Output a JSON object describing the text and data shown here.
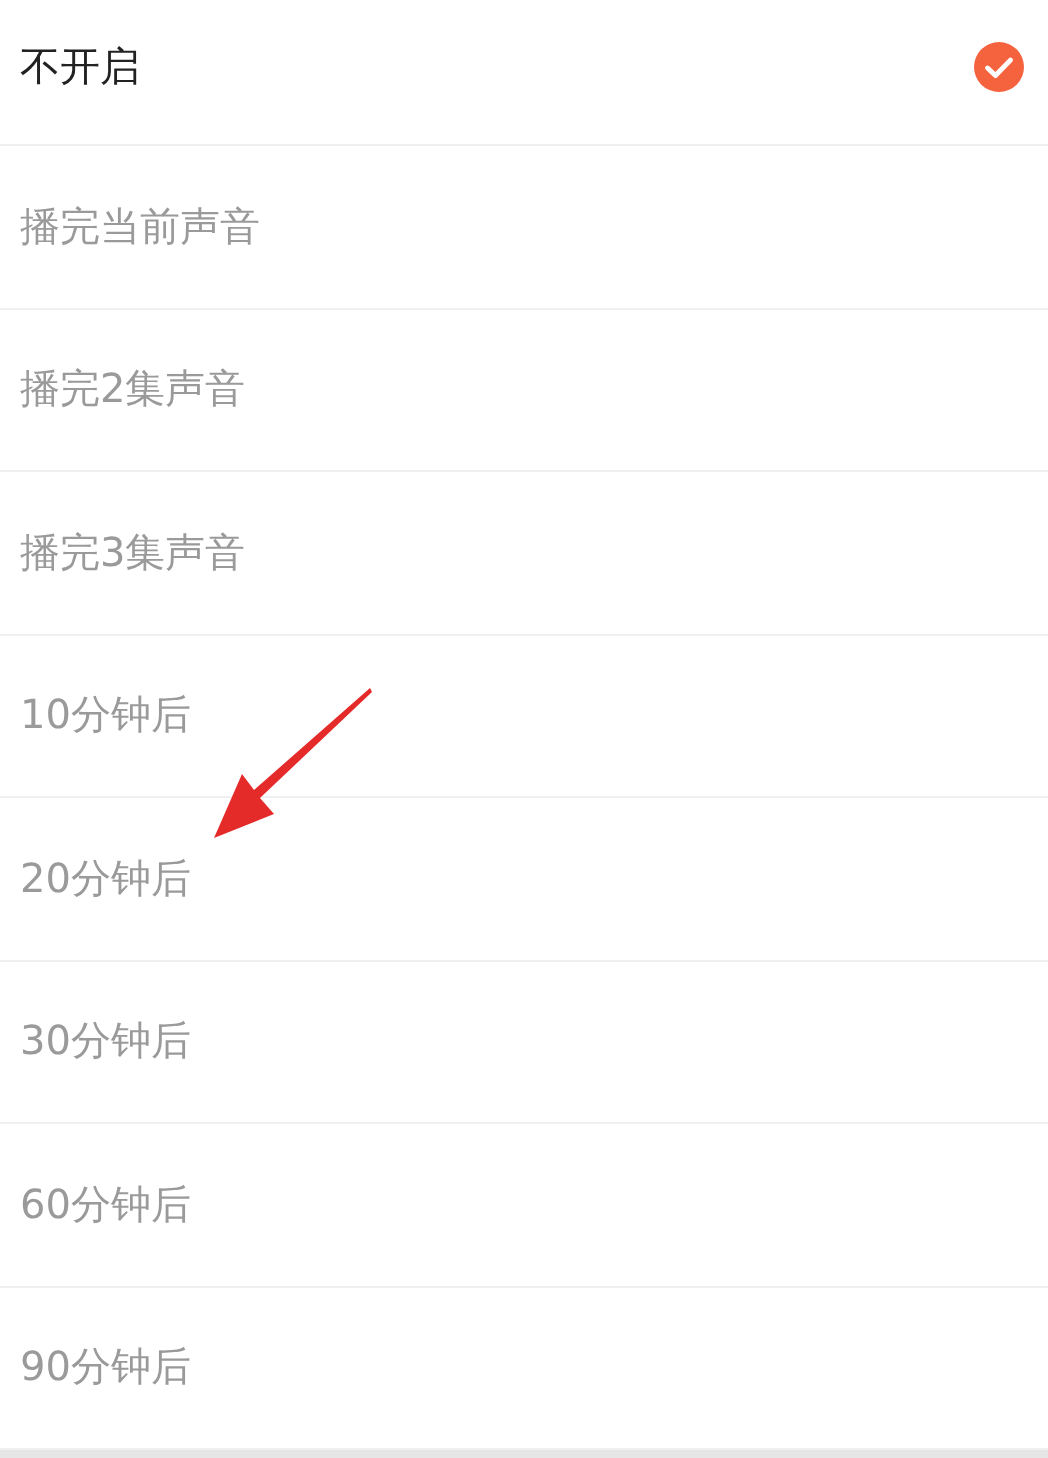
{
  "options": [
    {
      "label": "不开启",
      "selected": true
    },
    {
      "label": "播完当前声音",
      "selected": false
    },
    {
      "label": "播完2集声音",
      "selected": false
    },
    {
      "label": "播完3集声音",
      "selected": false
    },
    {
      "label": "10分钟后",
      "selected": false
    },
    {
      "label": "20分钟后",
      "selected": false
    },
    {
      "label": "30分钟后",
      "selected": false
    },
    {
      "label": "60分钟后",
      "selected": false
    },
    {
      "label": "90分钟后",
      "selected": false
    }
  ],
  "annotations": [
    {
      "kind": "arrow"
    }
  ]
}
